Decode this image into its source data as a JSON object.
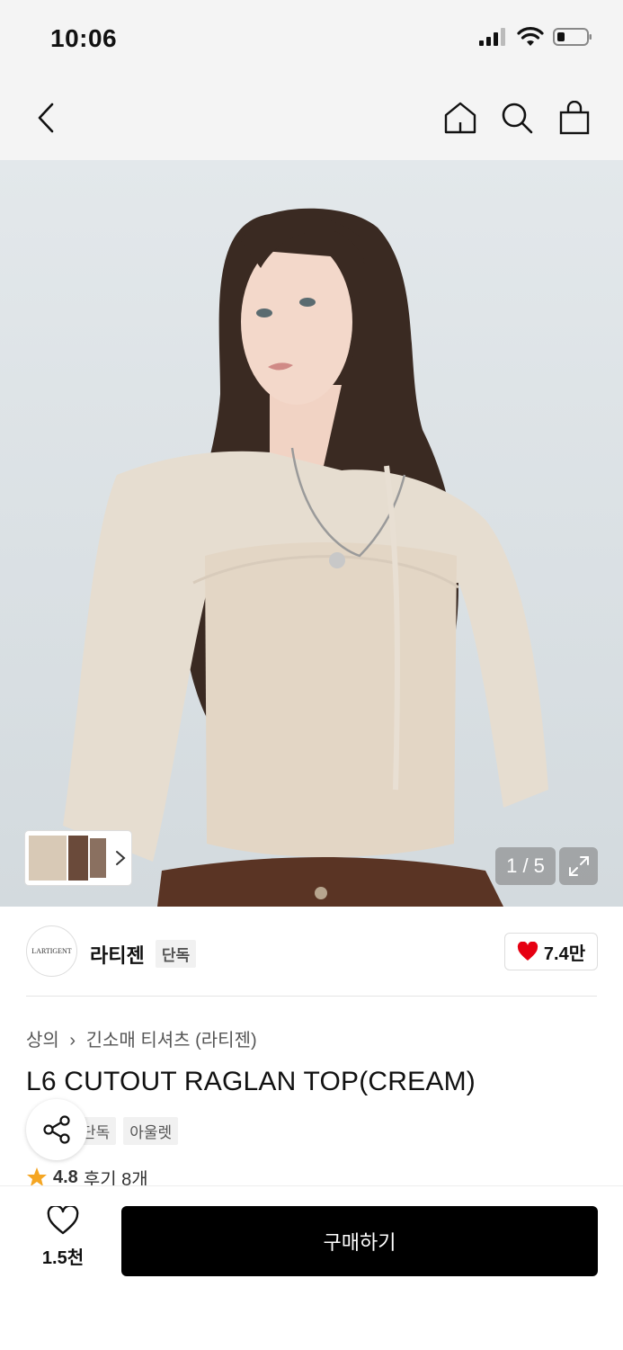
{
  "status": {
    "time": "10:06"
  },
  "hero": {
    "counter": "1 / 5"
  },
  "brand": {
    "logo_text": "LARTIGENT",
    "name": "라티젠",
    "tag": "단독",
    "likes": "7.4만"
  },
  "product": {
    "breadcrumb": [
      "상의",
      "긴소매 티셔츠 (라티젠)"
    ],
    "title": "L6 CUTOUT RAGLAN TOP(CREAM)",
    "tags": [
      "단독",
      "아울렛"
    ],
    "rating": "4.8",
    "reviews": "후기 8개"
  },
  "bottom": {
    "wish_count": "1.5천",
    "buy_label": "구매하기"
  },
  "colors": {
    "heart": "#e60012",
    "star": "#f5a623",
    "buy_button": "#000000"
  }
}
